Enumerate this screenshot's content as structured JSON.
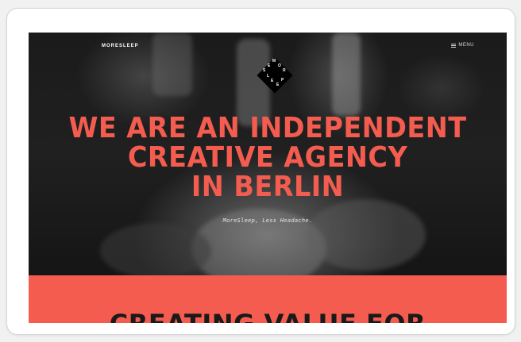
{
  "nav": {
    "logo": "MORESLEEP",
    "menu_label": "MENU"
  },
  "badge": {
    "letters": [
      "M",
      "O",
      "R",
      "E",
      "S",
      "L",
      "E",
      "E",
      "P"
    ]
  },
  "hero": {
    "headline_lines": [
      "WE ARE AN INDEPENDENT",
      "CREATIVE AGENCY",
      "IN BERLIN"
    ],
    "tagline": "MoreSleep, Less Headache."
  },
  "band": {
    "title": "CREATING VALUE FOR"
  },
  "colors": {
    "accent": "#f45c50",
    "hero_overlay": "#1b1b1b",
    "card_background": "#ffffff",
    "page_background": "#f1f1f1"
  }
}
